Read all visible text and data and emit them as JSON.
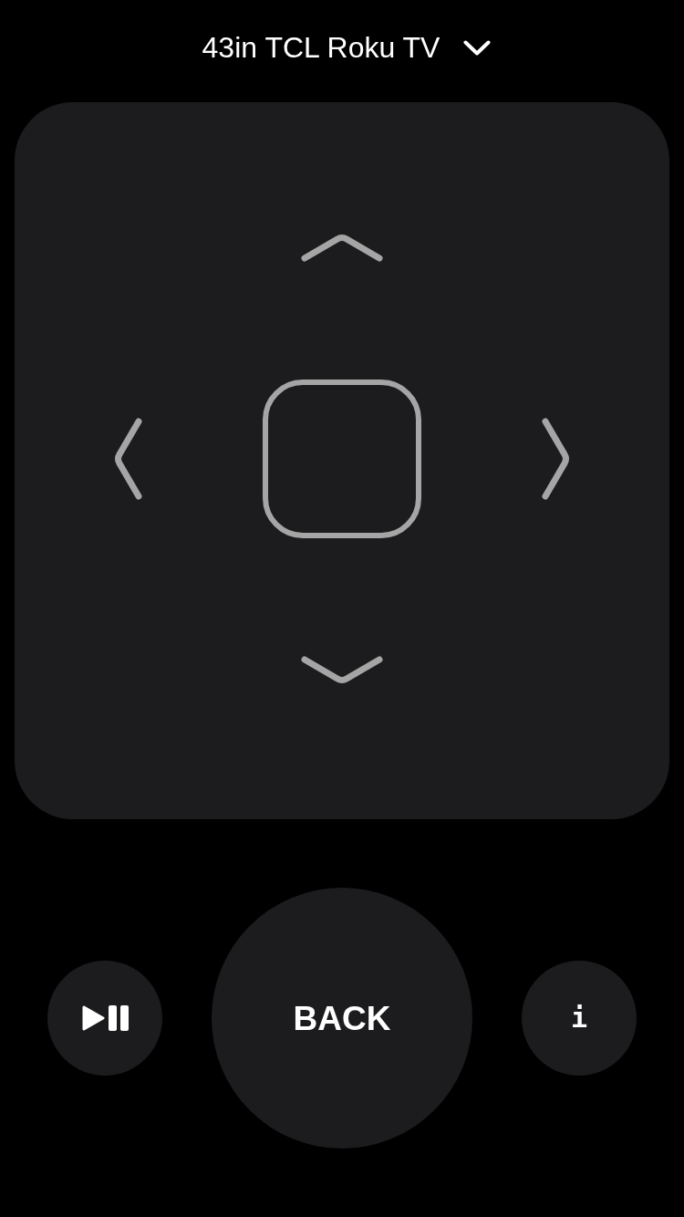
{
  "device_selector": {
    "label": "43in TCL Roku TV"
  },
  "bottom_buttons": [
    {
      "kind": "play_pause"
    },
    {
      "kind": "back",
      "label": "BACK"
    },
    {
      "kind": "info",
      "label": "i"
    }
  ]
}
